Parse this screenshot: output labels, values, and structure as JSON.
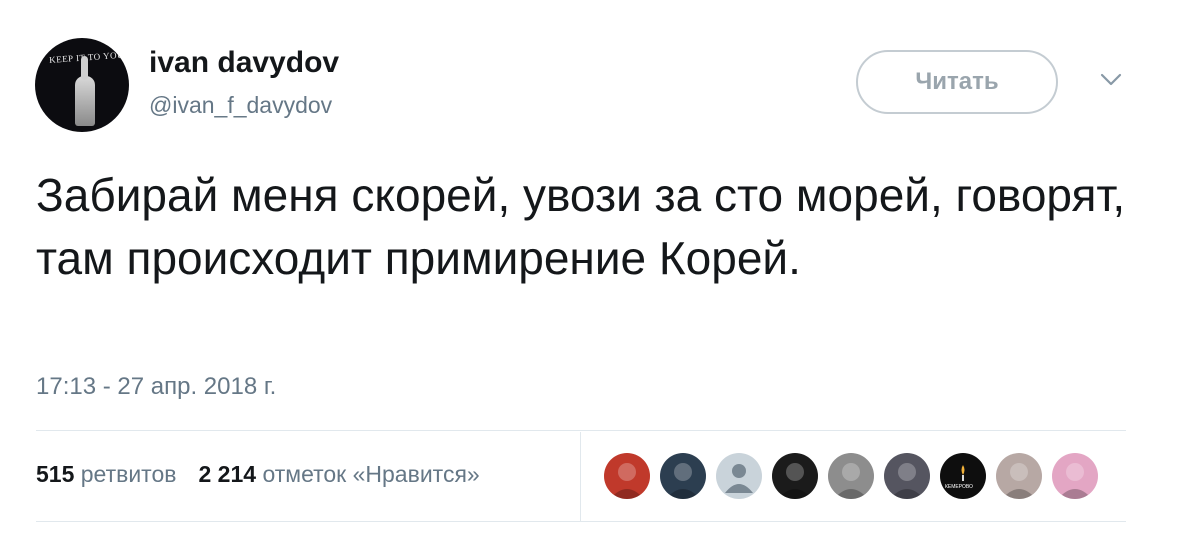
{
  "user": {
    "name": "ivan davydov",
    "handle": "@ivan_f_davydov",
    "avatar_caption": "KEEP IT TO YOURSELF BUDDY"
  },
  "follow_button": {
    "label": "Читать"
  },
  "menu": {
    "icon": "chevron-down-icon"
  },
  "tweet": {
    "text": "Забирай меня скорей, увози за сто морей, говорят, там происходит примирение Корей.",
    "timestamp": "17:13 - 27 апр. 2018 г."
  },
  "stats": {
    "retweets_count": "515",
    "retweets_label": "ретвитов",
    "likes_count": "2 214",
    "likes_label": "отметок «Нравится»"
  },
  "likers": [
    {
      "name": "liker-avatar-1",
      "color": "#c0392b"
    },
    {
      "name": "liker-avatar-2",
      "color": "#2c3e50"
    },
    {
      "name": "liker-avatar-3",
      "color": "#c9d3da"
    },
    {
      "name": "liker-avatar-4",
      "color": "#1b1b1b"
    },
    {
      "name": "liker-avatar-5",
      "color": "#8d8d8d"
    },
    {
      "name": "liker-avatar-6",
      "color": "#555560"
    },
    {
      "name": "liker-avatar-7",
      "color": "#0e0e0e"
    },
    {
      "name": "liker-avatar-8",
      "color": "#b7a8a4"
    },
    {
      "name": "liker-avatar-9",
      "color": "#e3a6c4"
    }
  ],
  "likers_extra": {
    "avatar_7_caption": "КЕМЕРОВО"
  }
}
